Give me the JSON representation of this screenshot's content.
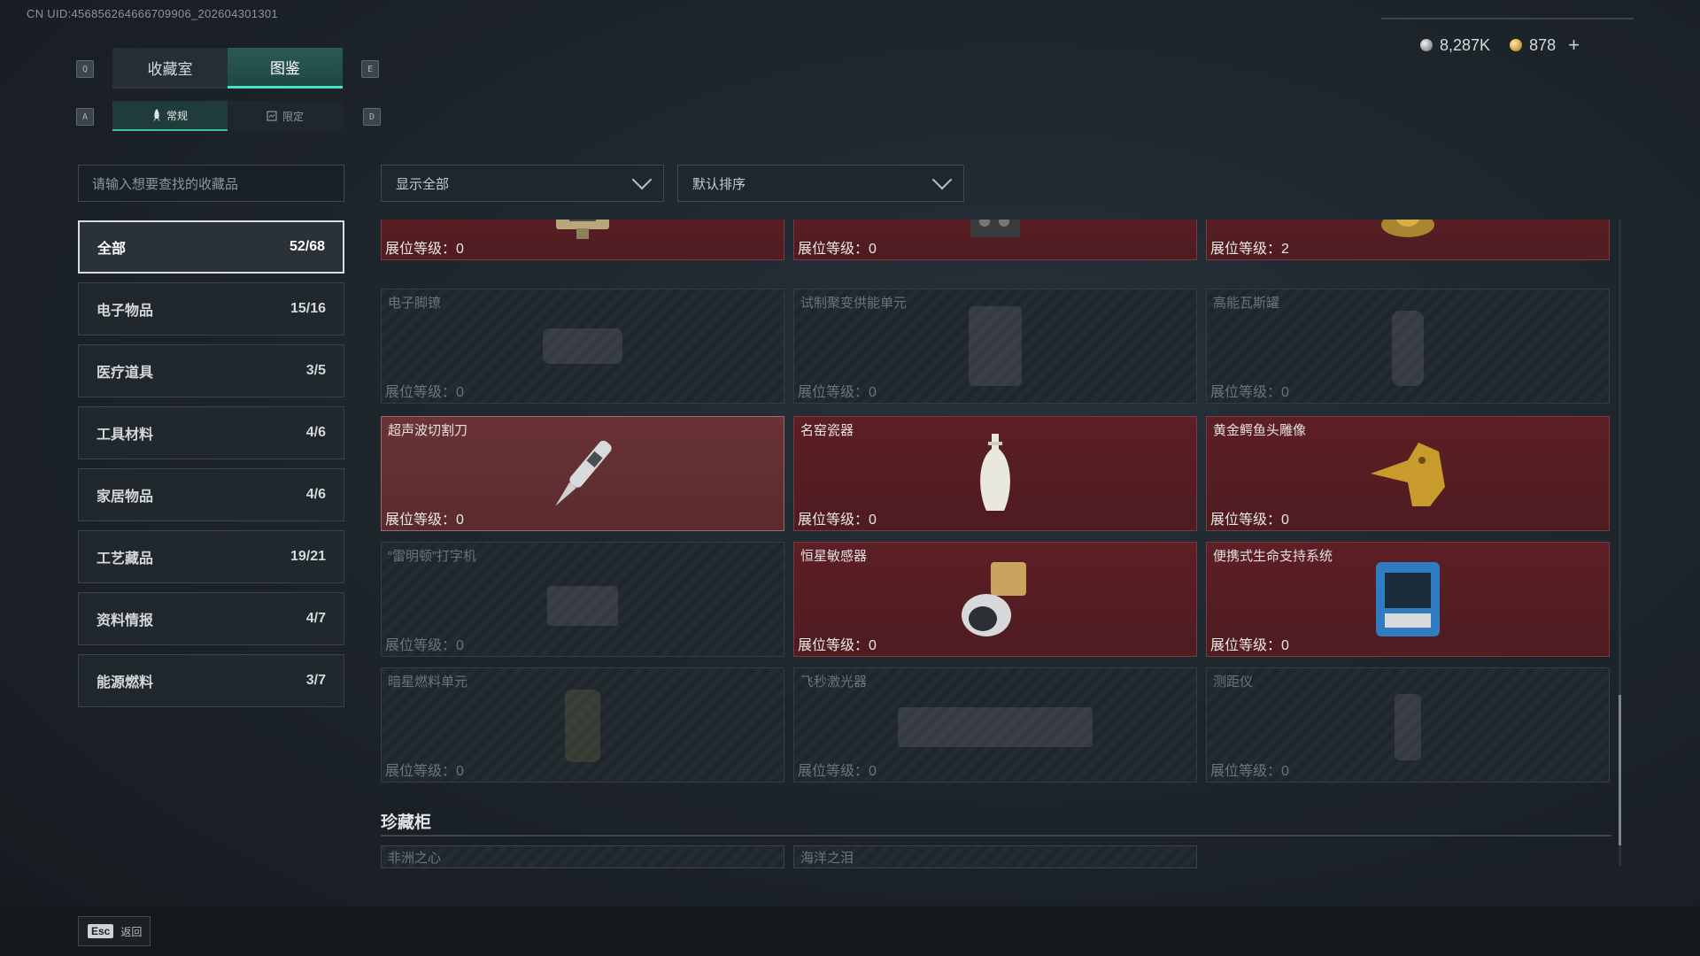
{
  "uid_text": "CN UID:456856264666709906_202604301301",
  "currency": {
    "silver": "8,287K",
    "gold": "878",
    "plus_icon": "+"
  },
  "keys": {
    "q": "Q",
    "e": "E",
    "a": "A",
    "d": "D"
  },
  "tabs": [
    {
      "label": "收藏室",
      "active": false
    },
    {
      "label": "图鉴",
      "active": true
    }
  ],
  "subtabs": [
    {
      "label": "常规",
      "icon": "rocket-icon",
      "active": true
    },
    {
      "label": "限定",
      "icon": "card-icon",
      "active": false
    }
  ],
  "search": {
    "placeholder": "请输入想要查找的收藏品"
  },
  "filters": {
    "show": "显示全部",
    "sort": "默认排序"
  },
  "categories": [
    {
      "label": "全部",
      "count": "52/68",
      "active": true
    },
    {
      "label": "电子物品",
      "count": "15/16"
    },
    {
      "label": "医疗道具",
      "count": "3/5"
    },
    {
      "label": "工具材料",
      "count": "4/6"
    },
    {
      "label": "家居物品",
      "count": "4/6"
    },
    {
      "label": "工艺藏品",
      "count": "19/21"
    },
    {
      "label": "资料情报",
      "count": "4/7"
    },
    {
      "label": "能源燃料",
      "count": "3/7"
    }
  ],
  "items": [
    {
      "name": "",
      "level": "展位等级：0",
      "state": "on",
      "icon": "device-icon"
    },
    {
      "name": "",
      "level": "展位等级：0",
      "state": "on",
      "icon": "radio-icon"
    },
    {
      "name": "",
      "level": "展位等级：2",
      "state": "on",
      "icon": "nest-egg-icon"
    },
    {
      "name": "电子脚镣",
      "level": "展位等级：0",
      "state": "off",
      "icon": "ankle-monitor-icon"
    },
    {
      "name": "试制聚变供能单元",
      "level": "展位等级：0",
      "state": "off",
      "icon": "fusion-unit-icon"
    },
    {
      "name": "高能瓦斯罐",
      "level": "展位等级：0",
      "state": "off",
      "icon": "gas-tank-icon"
    },
    {
      "name": "超声波切割刀",
      "level": "展位等级：0",
      "state": "sel",
      "icon": "ultrasonic-knife-icon"
    },
    {
      "name": "名窑瓷器",
      "level": "展位等级：0",
      "state": "on",
      "icon": "porcelain-vase-icon"
    },
    {
      "name": "黄金鳄鱼头雕像",
      "level": "展位等级：0",
      "state": "on",
      "icon": "gold-crocodile-icon"
    },
    {
      "name": "“雷明顿”打字机",
      "level": "展位等级：0",
      "state": "off",
      "icon": "typewriter-icon"
    },
    {
      "name": "恒星敏感器",
      "level": "展位等级：0",
      "state": "on",
      "icon": "star-sensor-icon"
    },
    {
      "name": "便携式生命支持系统",
      "level": "展位等级：0",
      "state": "on",
      "icon": "life-support-icon"
    },
    {
      "name": "暗星燃料单元",
      "level": "展位等级：0",
      "state": "off",
      "icon": "fuel-cell-icon"
    },
    {
      "name": "飞秒激光器",
      "level": "展位等级：0",
      "state": "off",
      "icon": "laser-icon"
    },
    {
      "name": "测距仪",
      "level": "展位等级：0",
      "state": "off",
      "icon": "rangefinder-icon"
    }
  ],
  "cabinet": {
    "title": "珍藏柜",
    "items": [
      "非洲之心",
      "海洋之泪"
    ]
  },
  "footer": {
    "esc_key": "Esc",
    "esc_label": "返回"
  }
}
